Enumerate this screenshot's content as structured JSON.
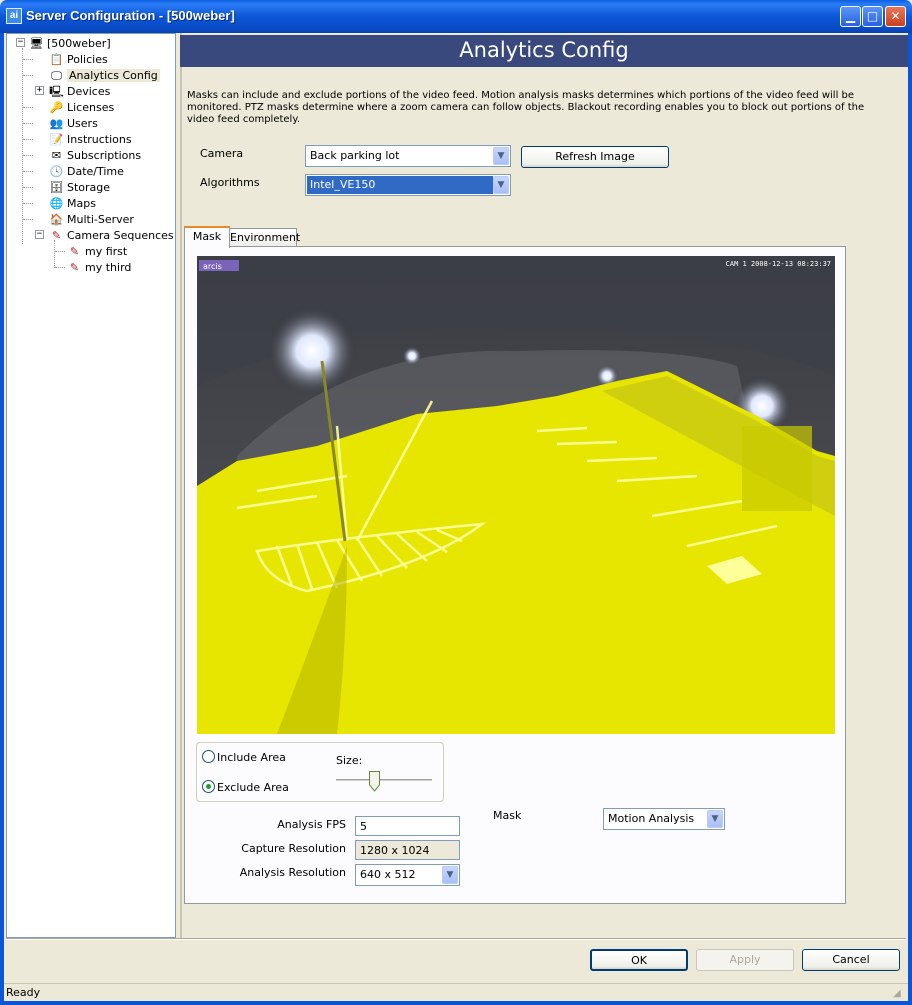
{
  "window": {
    "title": "Server Configuration - [500weber]",
    "app_icon_text": "ai"
  },
  "tree": {
    "root": "[500weber]",
    "items": [
      "Policies",
      "Analytics Config",
      "Devices",
      "Licenses",
      "Users",
      "Instructions",
      "Subscriptions",
      "Date/Time",
      "Storage",
      "Maps",
      "Multi-Server",
      "Camera Sequences"
    ],
    "sequences": [
      "my first",
      "my third"
    ],
    "selected": "Analytics Config"
  },
  "header": {
    "title": "Analytics Config"
  },
  "description": "Masks can include and exclude portions of the video feed.  Motion analysis masks determines which portions of the video feed will be monitored.  PTZ masks determine where a zoom camera can follow objects.  Blackout recording enables you to block out portions of the video feed completely.",
  "form": {
    "camera_label": "Camera",
    "camera_value": "Back parking lot",
    "algorithms_label": "Algorithms",
    "algorithms_value": "Intel_VE150",
    "refresh_button": "Refresh Image"
  },
  "tabs": [
    "Mask",
    "Environment"
  ],
  "video": {
    "logo_text": "arcis",
    "timestamp": "CAM 1 2008-12-13 08:23:37"
  },
  "mask_options": {
    "include_label": "Include Area",
    "exclude_label": "Exclude Area",
    "selected": "Exclude Area",
    "size_label": "Size:",
    "size_level": 0.4
  },
  "analysis": {
    "fps_label": "Analysis FPS",
    "fps_value": "5",
    "capture_label": "Capture Resolution",
    "capture_value": "1280 x 1024",
    "resolution_label": "Analysis Resolution",
    "resolution_value": "640 x 512",
    "mask_label": "Mask",
    "mask_value": "Motion Analysis"
  },
  "buttons": {
    "ok": "OK",
    "apply": "Apply",
    "cancel": "Cancel"
  },
  "status": "Ready",
  "colors": {
    "title_bar": "#0a5fe0",
    "header_bg": "#39497e",
    "mask_overlay": "#e6e600"
  }
}
